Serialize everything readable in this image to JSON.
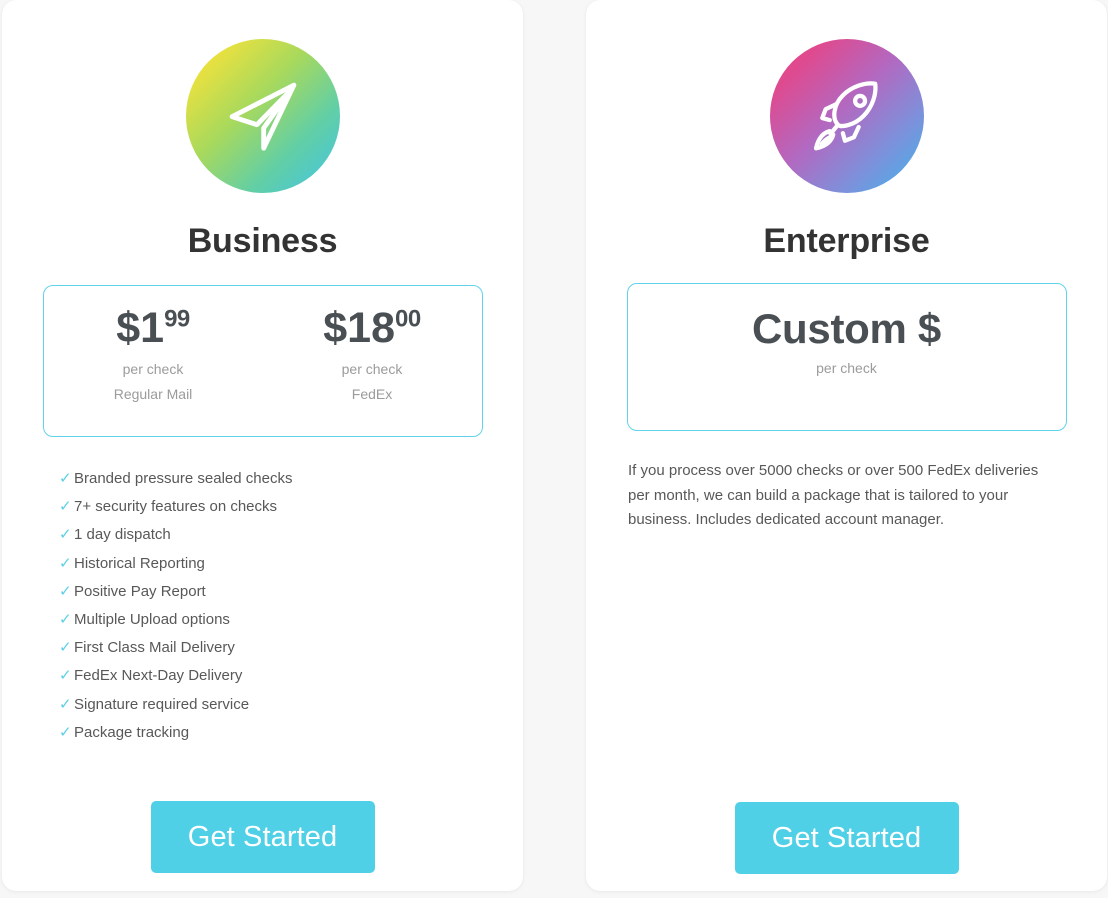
{
  "page": {
    "background_color": "#f7f7f7",
    "accent_color": "#4fd0e7",
    "price_box_border_color": "#62d3ec",
    "check_color": "#5ccfe6"
  },
  "plans": [
    {
      "id": "business",
      "icon_name": "paper-plane-icon",
      "icon_gradient_from": "#f7e335",
      "icon_gradient_to": "#40c4e8",
      "title": "Business",
      "prices": [
        {
          "amount": "$1",
          "cents": "99",
          "unit": "per check",
          "method": "Regular Mail"
        },
        {
          "amount": "$18",
          "cents": "00",
          "unit": "per check",
          "method": "FedEx"
        }
      ],
      "features": [
        "Branded pressure sealed checks",
        "7+ security features on checks",
        "1 day dispatch",
        "Historical Reporting",
        "Positive Pay Report",
        "Multiple Upload options",
        "First Class Mail Delivery",
        "FedEx Next-Day Delivery",
        "Signature required service",
        "Package tracking"
      ],
      "check_glyph": "✓",
      "cta_label": "Get Started"
    },
    {
      "id": "enterprise",
      "icon_name": "rocket-icon",
      "icon_gradient_from": "#e8447f",
      "icon_gradient_to": "#3fb6ec",
      "title": "Enterprise",
      "custom_amount": "Custom $",
      "custom_unit": "per check",
      "description": "If you process over 5000 checks or over 500 FedEx deliveries per month, we can build a package that is tailored to your business. Includes dedicated account manager.",
      "cta_label": "Get Started"
    }
  ]
}
